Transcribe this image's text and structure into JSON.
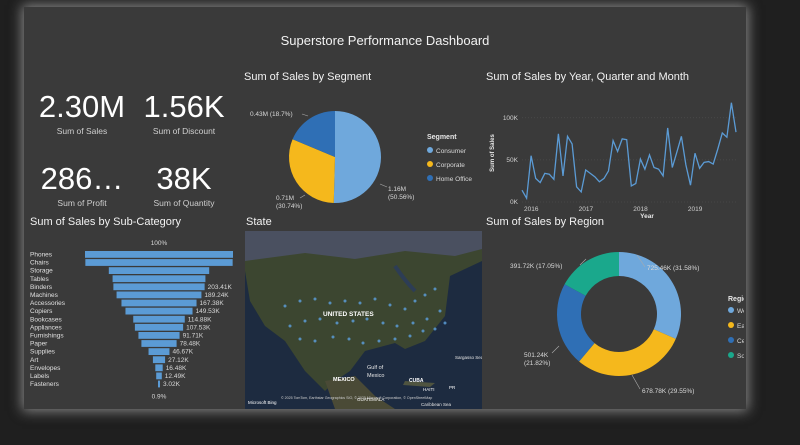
{
  "dashboard": {
    "title": "Superstore Performance Dashboard"
  },
  "kpis": [
    {
      "value": "2.30M",
      "label": "Sum of Sales"
    },
    {
      "value": "1.56K",
      "label": "Sum of Discount"
    },
    {
      "value": "286…",
      "label": "Sum of Profit"
    },
    {
      "value": "38K",
      "label": "Sum of Quantity"
    }
  ],
  "segment_chart": {
    "title": "Sum of Sales by Segment",
    "legend_title": "Segment",
    "labels": [
      "1.16M\n(50.56%)",
      "0.71M\n(30.74%)",
      "0.43M (18.7%)"
    ]
  },
  "trend_chart": {
    "title": "Sum of Sales by Year, Quarter and Month",
    "ylabel": "Sum of Sales",
    "xlabel": "Year",
    "yticks": [
      "100K",
      "50K",
      "0K"
    ],
    "xticks": [
      "2016",
      "2017",
      "2018",
      "2019"
    ]
  },
  "subcat_chart": {
    "title": "Sum of Sales by Sub-Category",
    "top_label": "100%",
    "bottom_label": "0.9%"
  },
  "map": {
    "title": "State",
    "labels": {
      "usa": "UNITED STATES",
      "mexico": "MEXICO",
      "gulf": "Gulf of\nMexico",
      "cuba": "CUBA",
      "guatemala": "GUATEMALA",
      "haiti": "HAITI",
      "pr": "PR",
      "caribbean": "Caribbean Sea",
      "sargasso": "Sargasso Sea",
      "logo": "Microsoft Bing",
      "copyright": "© 2025 TomTom, Earthstar Geographics SIO, © 2025 Microsoft Corporation, © OpenStreetMap"
    }
  },
  "region_chart": {
    "title": "Sum of Sales by Region",
    "legend_title": "Region",
    "labels": [
      "725.46K (31.58%)",
      "678.78K (29.55%)",
      "501.24K\n(21.82%)",
      "391.72K (17.05%)"
    ]
  },
  "colors": {
    "line": "#5b9bd5",
    "bar": "#5b9bd5",
    "consumer": "#6fa8dc",
    "corporate": "#f5b81c",
    "home_office": "#2f6fb5",
    "west": "#6fa8dc",
    "east": "#f5b81c",
    "central": "#2f6fb5",
    "south": "#1aa88c"
  },
  "chart_data": [
    {
      "type": "pie",
      "title": "Sum of Sales by Segment",
      "legend_title": "Segment",
      "legend_position": "right",
      "categories": [
        "Consumer",
        "Corporate",
        "Home Office"
      ],
      "values": [
        1160000,
        710000,
        430000
      ],
      "percent": [
        50.56,
        30.74,
        18.7
      ]
    },
    {
      "type": "line",
      "title": "Sum of Sales by Year, Quarter and Month",
      "xlabel": "Year",
      "ylabel": "Sum of Sales",
      "x": [
        "2016-01",
        "2016-02",
        "2016-03",
        "2016-04",
        "2016-05",
        "2016-06",
        "2016-07",
        "2016-08",
        "2016-09",
        "2016-10",
        "2016-11",
        "2016-12",
        "2017-01",
        "2017-02",
        "2017-03",
        "2017-04",
        "2017-05",
        "2017-06",
        "2017-07",
        "2017-08",
        "2017-09",
        "2017-10",
        "2017-11",
        "2017-12",
        "2018-01",
        "2018-02",
        "2018-03",
        "2018-04",
        "2018-05",
        "2018-06",
        "2018-07",
        "2018-08",
        "2018-09",
        "2018-10",
        "2018-11",
        "2018-12",
        "2019-01",
        "2019-02",
        "2019-03",
        "2019-04",
        "2019-05",
        "2019-06",
        "2019-07",
        "2019-08",
        "2019-09",
        "2019-10",
        "2019-11",
        "2019-12"
      ],
      "series": [
        {
          "values": [
            14000,
            4500,
            55000,
            28000,
            23000,
            34000,
            33000,
            27000,
            81000,
            31000,
            78000,
            69000,
            18000,
            12000,
            38000,
            34000,
            30000,
            24000,
            28000,
            37000,
            73000,
            60000,
            75000,
            74000,
            19000,
            22000,
            51000,
            39000,
            56000,
            41000,
            39000,
            31000,
            88000,
            41000,
            59000,
            78000,
            44000,
            20000,
            58000,
            40000,
            47000,
            48000,
            45000,
            63000,
            82000,
            77000,
            118000,
            83000
          ]
        }
      ],
      "ylim": [
        0,
        120000
      ],
      "yticks": [
        0,
        50000,
        100000
      ]
    },
    {
      "type": "bar",
      "title": "Sum of Sales by Sub-Category",
      "categories": [
        "Phones",
        "Chairs",
        "Storage",
        "Tables",
        "Binders",
        "Machines",
        "Accessories",
        "Copiers",
        "Bookcases",
        "Appliances",
        "Furnishings",
        "Paper",
        "Supplies",
        "Art",
        "Envelopes",
        "Labels",
        "Fasteners"
      ],
      "values": [
        330010,
        328450,
        223840,
        206970,
        203410,
        189240,
        167380,
        149530,
        114880,
        107530,
        91710,
        78480,
        46670,
        27120,
        16480,
        12490,
        3020
      ],
      "data_labels": [
        "",
        "",
        "",
        "",
        "203.41K",
        "189.24K",
        "167.38K",
        "149.53K",
        "114.88K",
        "107.53K",
        "91.71K",
        "78.48K",
        "46.67K",
        "27.12K",
        "16.48K",
        "12.49K",
        "3.02K"
      ],
      "annotations": [
        "100%",
        "0.9%"
      ]
    },
    {
      "type": "pie",
      "title": "Sum of Sales by Region",
      "legend_title": "Region",
      "legend_position": "right",
      "categories": [
        "West",
        "East",
        "Central",
        "South"
      ],
      "values": [
        725460,
        678780,
        501240,
        391720
      ],
      "percent": [
        31.58,
        29.55,
        21.82,
        17.05
      ]
    }
  ]
}
